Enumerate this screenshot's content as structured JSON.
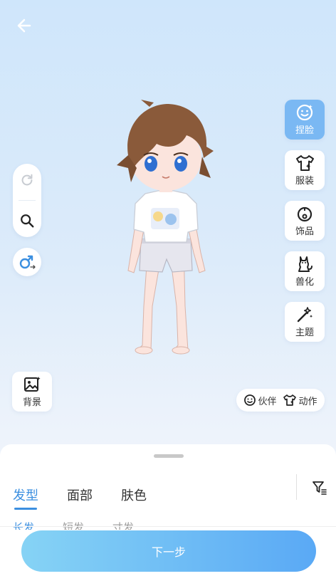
{
  "header": {
    "back_icon": "arrow-left-icon"
  },
  "left_tools": {
    "redo_icon": "redo-icon",
    "zoom_icon": "magnifier-icon",
    "gender_icon": "gender-swap-icon"
  },
  "right_menu": [
    {
      "label": "捏脸",
      "icon": "face-smile-icon",
      "active": true
    },
    {
      "label": "服装",
      "icon": "shirt-icon",
      "active": false
    },
    {
      "label": "饰品",
      "icon": "accessory-icon",
      "active": false
    },
    {
      "label": "兽化",
      "icon": "cat-icon",
      "active": false
    },
    {
      "label": "主题",
      "icon": "magic-wand-icon",
      "active": false
    }
  ],
  "background_button": {
    "label": "背景",
    "icon": "image-icon"
  },
  "quick_actions": {
    "partner_label": "伙伴",
    "action_label": "动作"
  },
  "panel": {
    "tabs": [
      {
        "label": "发型",
        "active": true
      },
      {
        "label": "面部",
        "active": false
      },
      {
        "label": "肤色",
        "active": false
      }
    ],
    "subtabs": [
      {
        "label": "长发",
        "active": true
      },
      {
        "label": "短发",
        "active": false
      },
      {
        "label": "寸发",
        "active": false
      }
    ],
    "filter_icon": "filter-icon"
  },
  "next_button": {
    "label": "下一步"
  },
  "colors": {
    "accent": "#3b8fe0",
    "active_button": "#7ab8f3"
  }
}
